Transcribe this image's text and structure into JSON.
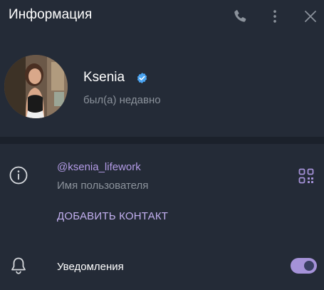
{
  "header": {
    "title": "Информация",
    "icons": [
      "phone-icon",
      "more-vertical-icon",
      "close-icon"
    ]
  },
  "profile": {
    "name": "Ksenia",
    "status": "был(а) недавно",
    "verified_icon": "verified-badge-icon"
  },
  "info": {
    "username": "@ksenia_lifework",
    "username_caption": "Имя пользователя",
    "add_contact_label": "ДОБАВИТЬ КОНТАКТ"
  },
  "notifications": {
    "label": "Уведомления",
    "enabled": true
  },
  "colors": {
    "background": "#242b37",
    "accent": "#b39be6",
    "muted_text": "#8b929b",
    "verified": "#4aa3f0"
  }
}
